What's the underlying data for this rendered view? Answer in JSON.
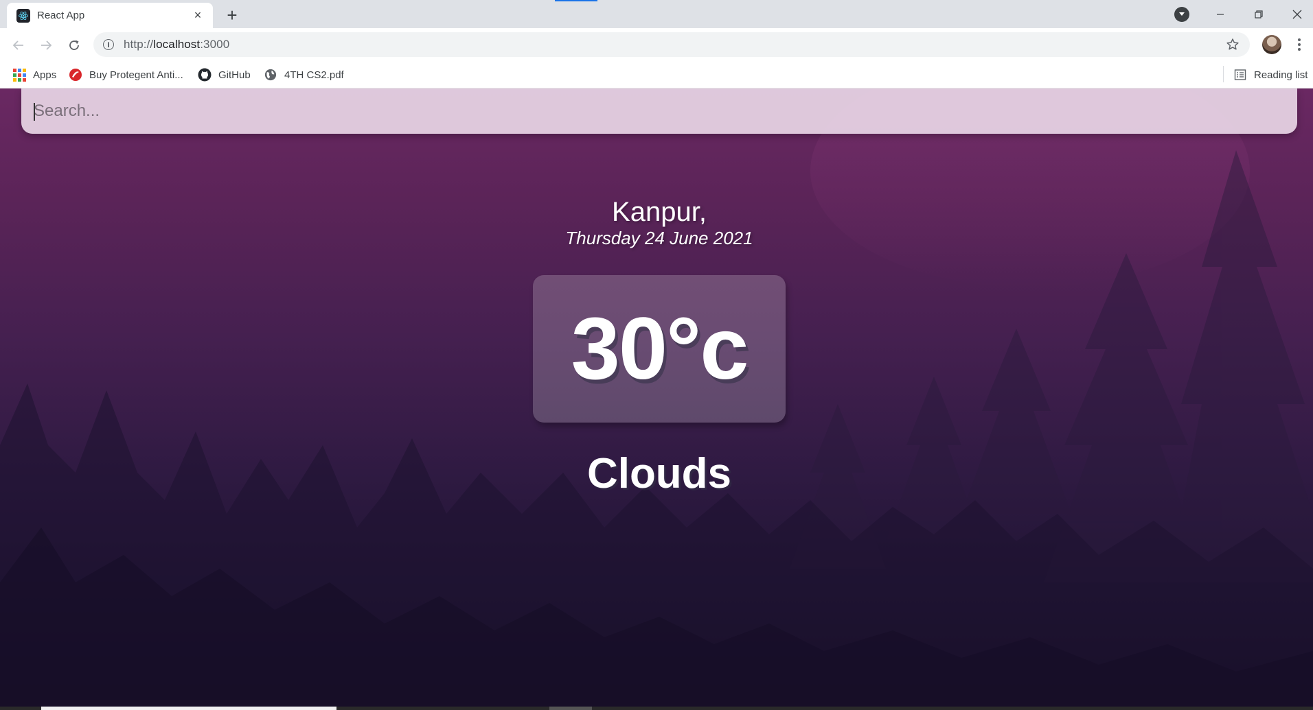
{
  "browser": {
    "tab": {
      "title": "React App",
      "close_label": "×"
    },
    "new_tab_label": "+",
    "address": {
      "scheme": "http://",
      "host": "localhost",
      "port": ":3000"
    },
    "bookmarks": [
      {
        "label": "Apps",
        "icon": "apps-grid-icon"
      },
      {
        "label": "Buy Protegent Anti...",
        "icon": "protegent-icon"
      },
      {
        "label": "GitHub",
        "icon": "github-icon"
      },
      {
        "label": "4TH CS2.pdf",
        "icon": "globe-icon"
      }
    ],
    "reading_list_label": "Reading list"
  },
  "app": {
    "search": {
      "placeholder": "Search..."
    },
    "location": "Kanpur,",
    "date": "Thursday 24 June 2021",
    "temperature": "30°c",
    "weather": "Clouds"
  }
}
